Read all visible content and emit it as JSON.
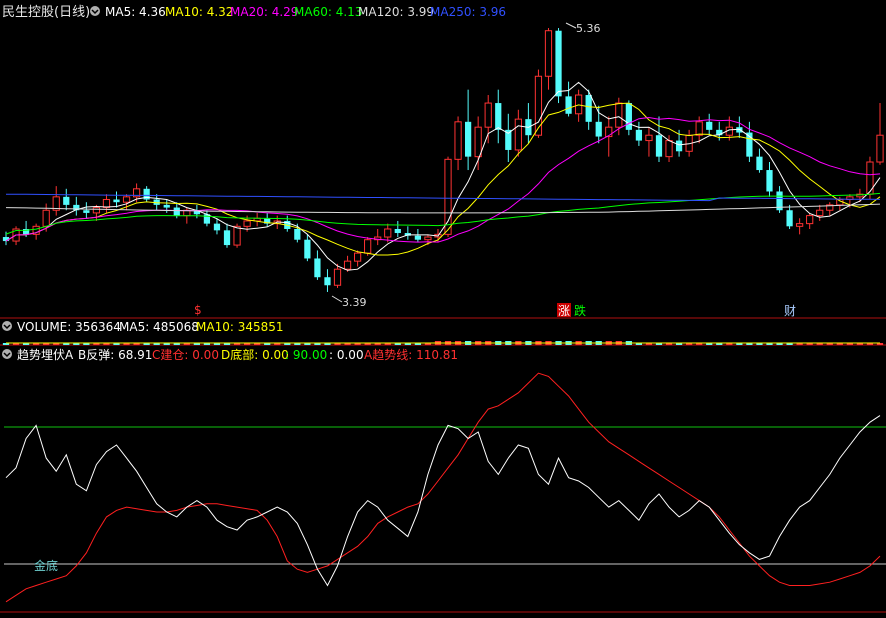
{
  "colors": {
    "up": "#ff3333",
    "down": "#54fcfc",
    "ma5": "#ffffff",
    "ma10": "#ffff00",
    "ma20": "#ff00ff",
    "ma60": "#00ff00",
    "ma120": "#dddddd",
    "ma250": "#3050ff",
    "panel_border": "#b01010",
    "white_line": "#ffffff",
    "red_line": "#ff2020",
    "green_hline": "#10c010",
    "gray_hline": "#c8c8c8"
  },
  "header": {
    "stock": "民生控股(日线)",
    "ma5": "MA5: 4.36",
    "ma10": "MA10: 4.32",
    "ma20": "MA20: 4.29",
    "ma60": "MA60: 4.13",
    "ma120": "MA120: 3.99",
    "ma250": "MA250: 3.96"
  },
  "volume_header": {
    "volume": "VOLUME: 356364",
    "ma5": "MA5: 485068",
    "ma10": "MA10: 345851"
  },
  "indicator_header": {
    "name": "趋势埋伏A",
    "b": "B反弹: 68.91",
    "c": "C建仓: 0.00",
    "d": "D底部: 0.00",
    "e": ": 90.00",
    "f": ": 0.00",
    "a": "A趋势线: 110.81"
  },
  "price_annotations": {
    "high": "5.36",
    "low": "3.39"
  },
  "markers": {
    "s": {
      "text": "$",
      "color": "#ff3030"
    },
    "zhang": {
      "text": "涨",
      "color": "#ffffff",
      "bg": "#cc0000"
    },
    "die": {
      "text": "跌",
      "color": "#00ff00"
    },
    "cai": {
      "text": "财",
      "color": "#aaccff"
    }
  },
  "indicator_label": "金底",
  "chart_data": {
    "type": "candlestick",
    "y_range": [
      3.33,
      5.42
    ],
    "ohlc": [
      [
        3.8,
        3.84,
        3.74,
        3.77
      ],
      [
        3.77,
        3.88,
        3.74,
        3.86
      ],
      [
        3.86,
        3.92,
        3.8,
        3.82
      ],
      [
        3.82,
        3.9,
        3.78,
        3.88
      ],
      [
        3.88,
        4.05,
        3.84,
        4.0
      ],
      [
        4.0,
        4.18,
        3.96,
        4.1
      ],
      [
        4.1,
        4.16,
        4.0,
        4.04
      ],
      [
        4.04,
        4.1,
        3.96,
        4.0
      ],
      [
        4.0,
        4.06,
        3.94,
        3.98
      ],
      [
        3.98,
        4.04,
        3.92,
        4.02
      ],
      [
        4.02,
        4.12,
        3.98,
        4.08
      ],
      [
        4.08,
        4.14,
        4.02,
        4.06
      ],
      [
        4.06,
        4.12,
        4.0,
        4.1
      ],
      [
        4.1,
        4.2,
        4.06,
        4.16
      ],
      [
        4.16,
        4.18,
        4.06,
        4.08
      ],
      [
        4.08,
        4.12,
        4.0,
        4.04
      ],
      [
        4.04,
        4.08,
        3.98,
        4.02
      ],
      [
        4.02,
        4.06,
        3.94,
        3.96
      ],
      [
        3.96,
        4.02,
        3.9,
        4.0
      ],
      [
        4.0,
        4.04,
        3.94,
        3.97
      ],
      [
        3.97,
        4.0,
        3.88,
        3.9
      ],
      [
        3.9,
        3.94,
        3.82,
        3.85
      ],
      [
        3.85,
        3.9,
        3.72,
        3.74
      ],
      [
        3.74,
        3.9,
        3.72,
        3.88
      ],
      [
        3.88,
        3.96,
        3.84,
        3.92
      ],
      [
        3.92,
        3.98,
        3.88,
        3.94
      ],
      [
        3.94,
        3.98,
        3.88,
        3.9
      ],
      [
        3.9,
        3.96,
        3.86,
        3.92
      ],
      [
        3.92,
        3.96,
        3.84,
        3.86
      ],
      [
        3.86,
        3.9,
        3.76,
        3.78
      ],
      [
        3.78,
        3.82,
        3.62,
        3.64
      ],
      [
        3.64,
        3.7,
        3.48,
        3.5
      ],
      [
        3.5,
        3.56,
        3.39,
        3.44
      ],
      [
        3.44,
        3.6,
        3.42,
        3.56
      ],
      [
        3.56,
        3.66,
        3.54,
        3.62
      ],
      [
        3.62,
        3.7,
        3.58,
        3.68
      ],
      [
        3.68,
        3.8,
        3.66,
        3.78
      ],
      [
        3.78,
        3.86,
        3.74,
        3.8
      ],
      [
        3.8,
        3.9,
        3.76,
        3.86
      ],
      [
        3.86,
        3.92,
        3.8,
        3.83
      ],
      [
        3.83,
        3.88,
        3.78,
        3.81
      ],
      [
        3.81,
        3.86,
        3.76,
        3.78
      ],
      [
        3.78,
        3.82,
        3.74,
        3.8
      ],
      [
        3.8,
        3.86,
        3.76,
        3.82
      ],
      [
        3.82,
        4.4,
        3.8,
        4.38
      ],
      [
        4.38,
        4.7,
        4.3,
        4.66
      ],
      [
        4.66,
        4.9,
        4.3,
        4.4
      ],
      [
        4.4,
        4.7,
        4.3,
        4.62
      ],
      [
        4.62,
        4.86,
        4.5,
        4.8
      ],
      [
        4.8,
        4.9,
        4.5,
        4.6
      ],
      [
        4.6,
        4.72,
        4.36,
        4.45
      ],
      [
        4.45,
        4.75,
        4.4,
        4.68
      ],
      [
        4.68,
        4.8,
        4.5,
        4.56
      ],
      [
        4.56,
        5.05,
        4.54,
        5.0
      ],
      [
        5.0,
        5.36,
        4.9,
        5.34
      ],
      [
        5.34,
        5.36,
        4.8,
        4.85
      ],
      [
        4.85,
        4.96,
        4.7,
        4.72
      ],
      [
        4.72,
        4.9,
        4.66,
        4.86
      ],
      [
        4.86,
        4.9,
        4.6,
        4.66
      ],
      [
        4.66,
        4.78,
        4.5,
        4.55
      ],
      [
        4.55,
        4.7,
        4.4,
        4.62
      ],
      [
        4.62,
        4.84,
        4.56,
        4.8
      ],
      [
        4.8,
        4.82,
        4.56,
        4.6
      ],
      [
        4.6,
        4.66,
        4.48,
        4.52
      ],
      [
        4.52,
        4.62,
        4.4,
        4.56
      ],
      [
        4.56,
        4.7,
        4.36,
        4.4
      ],
      [
        4.4,
        4.56,
        4.36,
        4.52
      ],
      [
        4.52,
        4.6,
        4.4,
        4.44
      ],
      [
        4.44,
        4.6,
        4.4,
        4.56
      ],
      [
        4.56,
        4.7,
        4.5,
        4.66
      ],
      [
        4.66,
        4.72,
        4.56,
        4.6
      ],
      [
        4.6,
        4.66,
        4.52,
        4.56
      ],
      [
        4.56,
        4.7,
        4.52,
        4.62
      ],
      [
        4.62,
        4.7,
        4.54,
        4.58
      ],
      [
        4.58,
        4.66,
        4.36,
        4.4
      ],
      [
        4.4,
        4.46,
        4.28,
        4.3
      ],
      [
        4.3,
        4.36,
        4.1,
        4.14
      ],
      [
        4.14,
        4.18,
        3.98,
        4.0
      ],
      [
        4.0,
        4.04,
        3.86,
        3.88
      ],
      [
        3.88,
        3.94,
        3.82,
        3.9
      ],
      [
        3.9,
        3.98,
        3.86,
        3.96
      ],
      [
        3.96,
        4.04,
        3.92,
        4.0
      ],
      [
        4.0,
        4.06,
        3.96,
        4.04
      ],
      [
        4.04,
        4.1,
        4.0,
        4.08
      ],
      [
        4.08,
        4.12,
        4.02,
        4.1
      ],
      [
        4.1,
        4.16,
        4.06,
        4.12
      ],
      [
        4.12,
        4.4,
        4.08,
        4.36
      ],
      [
        4.36,
        4.8,
        4.34,
        4.56
      ]
    ],
    "indicator_range": [
      -5,
      145
    ],
    "b_line": [
      76,
      82,
      100,
      108,
      88,
      80,
      90,
      72,
      68,
      84,
      92,
      96,
      88,
      80,
      70,
      60,
      55,
      52,
      58,
      62,
      58,
      50,
      46,
      44,
      50,
      52,
      55,
      58,
      55,
      48,
      35,
      20,
      10,
      22,
      40,
      55,
      62,
      58,
      50,
      45,
      40,
      55,
      78,
      96,
      108,
      106,
      100,
      104,
      86,
      78,
      88,
      96,
      94,
      78,
      72,
      88,
      76,
      74,
      70,
      64,
      58,
      62,
      56,
      50,
      60,
      66,
      58,
      52,
      56,
      62,
      58,
      50,
      42,
      35,
      30,
      26,
      28,
      40,
      50,
      58,
      62,
      70,
      78,
      88,
      96,
      104,
      110,
      114
    ],
    "a_line": [
      0,
      4,
      8,
      10,
      12,
      14,
      16,
      22,
      30,
      42,
      52,
      56,
      58,
      57,
      56,
      55,
      55,
      56,
      58,
      59,
      60,
      60,
      59,
      58,
      57,
      56,
      50,
      40,
      25,
      20,
      18,
      20,
      22,
      26,
      30,
      34,
      40,
      48,
      52,
      55,
      58,
      60,
      66,
      74,
      82,
      90,
      100,
      110,
      118,
      120,
      124,
      128,
      134,
      140,
      138,
      132,
      126,
      118,
      110,
      104,
      98,
      94,
      90,
      86,
      82,
      78,
      74,
      70,
      66,
      62,
      58,
      52,
      44,
      36,
      28,
      22,
      16,
      12,
      10,
      10,
      10,
      11,
      12,
      14,
      16,
      18,
      22,
      28
    ]
  }
}
